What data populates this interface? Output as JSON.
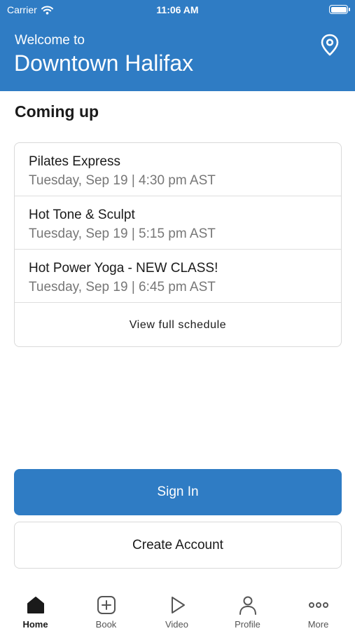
{
  "status_bar": {
    "carrier": "Carrier",
    "time": "11:06 AM"
  },
  "header": {
    "welcome": "Welcome to",
    "location": "Downtown Halifax"
  },
  "section_title": "Coming up",
  "classes": [
    {
      "name": "Pilates Express",
      "when": "Tuesday, Sep 19 | 4:30 pm AST"
    },
    {
      "name": "Hot Tone & Sculpt",
      "when": "Tuesday, Sep 19 | 5:15 pm AST"
    },
    {
      "name": "Hot Power Yoga - NEW CLASS!",
      "when": "Tuesday, Sep 19 | 6:45 pm AST"
    }
  ],
  "view_schedule": "View full schedule",
  "buttons": {
    "sign_in": "Sign In",
    "create_account": "Create Account"
  },
  "tabs": [
    {
      "label": "Home",
      "icon": "home-icon",
      "active": true
    },
    {
      "label": "Book",
      "icon": "plus-square-icon"
    },
    {
      "label": "Video",
      "icon": "play-icon"
    },
    {
      "label": "Profile",
      "icon": "person-icon"
    },
    {
      "label": "More",
      "icon": "more-icon"
    }
  ],
  "colors": {
    "accent": "#2f7cc4",
    "muted_text": "#777777",
    "border": "#d9d9d9"
  }
}
